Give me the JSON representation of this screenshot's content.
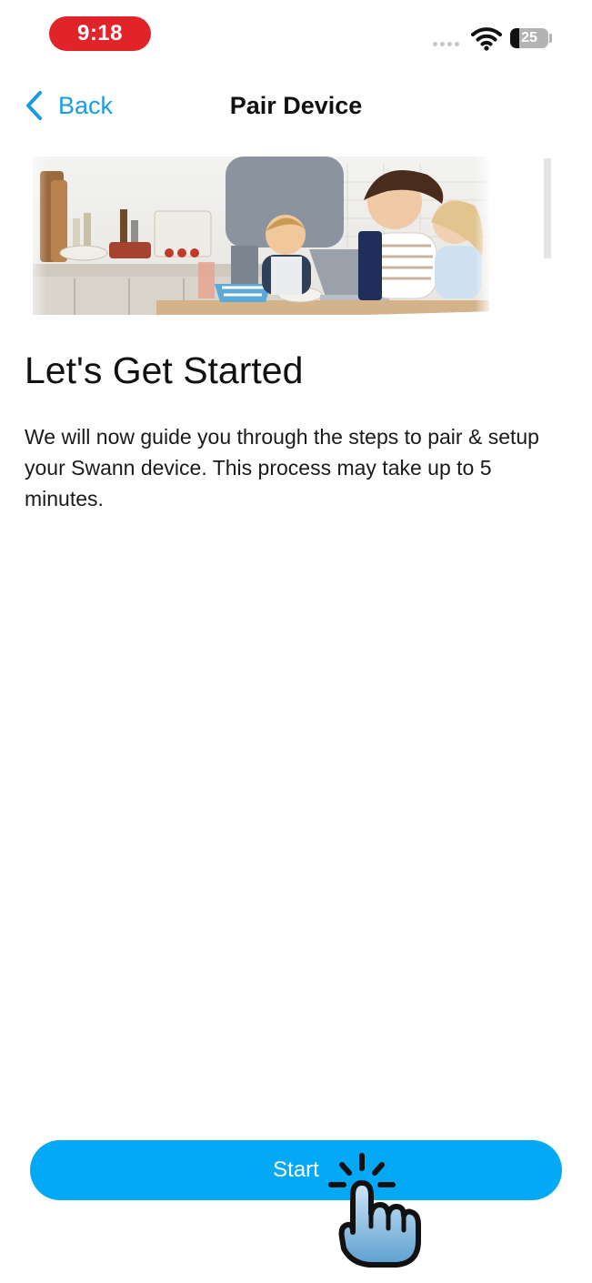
{
  "status_bar": {
    "time": "9:18",
    "battery_level": "25",
    "time_badge_color": "#e0242a"
  },
  "nav": {
    "back_label": "Back",
    "title": "Pair Device",
    "accent_color": "#1a9be6"
  },
  "hero": {
    "icon": "family-kitchen-illustration"
  },
  "content": {
    "heading": "Let's Get Started",
    "body": "We will now guide you through the steps to pair & setup your Swann device. This process may take up to 5 minutes."
  },
  "footer": {
    "start_label": "Start",
    "button_color": "#03a9f4",
    "overlay_icon": "tap-hand-icon"
  }
}
